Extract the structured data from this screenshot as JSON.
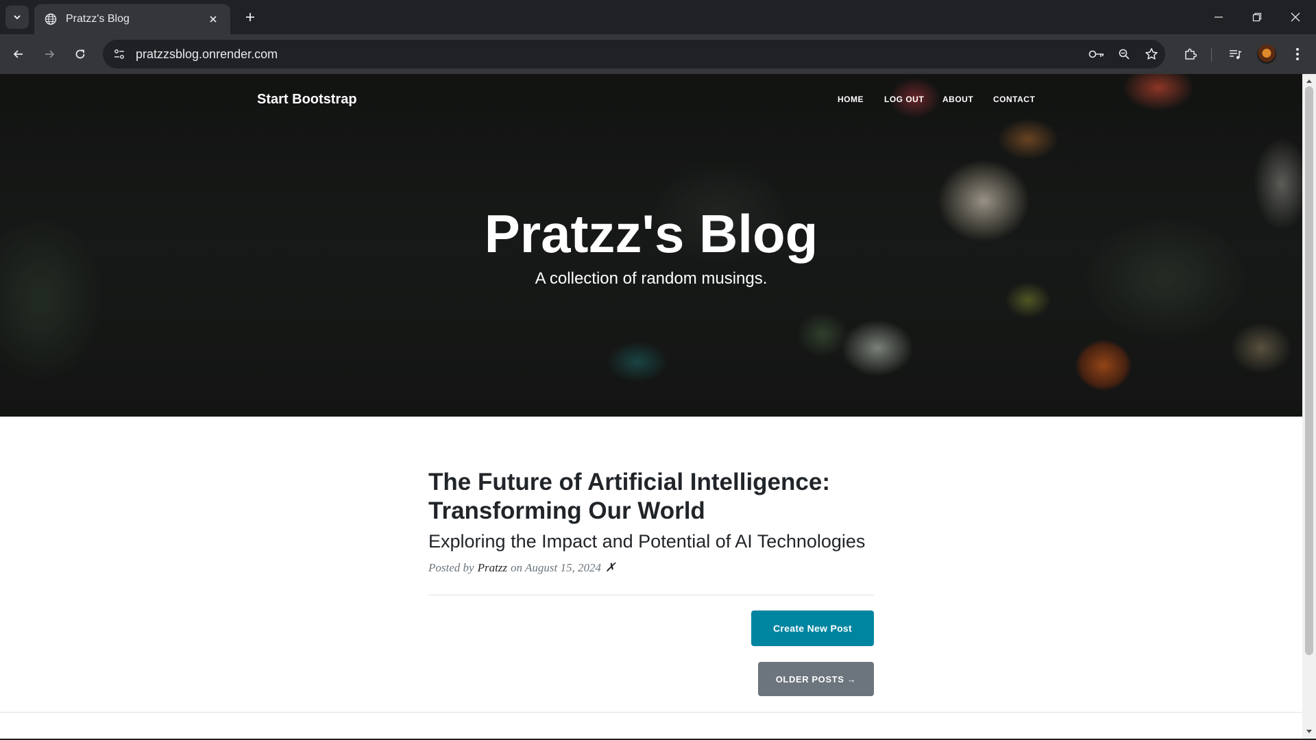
{
  "browser": {
    "tab_title": "Pratzz's Blog",
    "url": "pratzzsblog.onrender.com"
  },
  "site": {
    "brand": "Start Bootstrap",
    "nav": [
      "HOME",
      "LOG OUT",
      "ABOUT",
      "CONTACT"
    ],
    "hero_title": "Pratzz's Blog",
    "hero_subtitle": "A collection of random musings."
  },
  "post": {
    "title_line1": "The Future of Artificial Intelligence:",
    "title_line2": "Transforming Our World",
    "subtitle": "Exploring the Impact and Potential of AI Technologies",
    "meta_prefix": "Posted by",
    "author": "Pratzz",
    "meta_on": "on August 15, 2024",
    "delete_glyph": "✗"
  },
  "buttons": {
    "create": "Create New Post",
    "older": "OLDER POSTS →"
  },
  "colors": {
    "accent": "#0085a1",
    "secondary": "#6c757d"
  }
}
